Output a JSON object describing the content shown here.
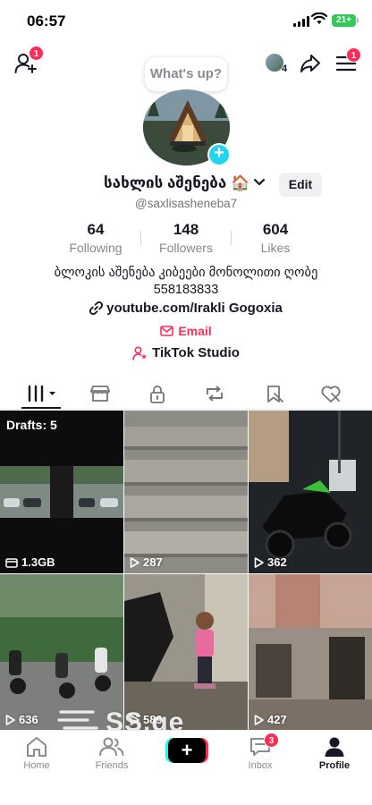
{
  "status_bar": {
    "time": "06:57",
    "battery": "21+"
  },
  "top": {
    "add_friend_badge": "1",
    "mini_avatar_count": "4",
    "menu_badge": "1",
    "whats_up": "What's up?"
  },
  "profile": {
    "name": "სახლის აშენება 🏠",
    "handle": "@saxlisasheneba7",
    "edit_label": "Edit",
    "following_count": "64",
    "following_label": "Following",
    "followers_count": "148",
    "followers_label": "Followers",
    "likes_count": "604",
    "likes_label": "Likes",
    "bio_line1": "ბლოკის აშენება კიბეები მონოლითი ღობე",
    "bio_line2": "558183833",
    "link": "youtube.com/Irakli Gogoxia",
    "email_label": "Email",
    "studio_label": "TikTok Studio"
  },
  "tabs": [
    "videos-tab",
    "shop-tab",
    "private-tab",
    "reposts-tab",
    "favorites-tab",
    "liked-tab"
  ],
  "grid": {
    "drafts_label": "Drafts: 5",
    "items": [
      {
        "views": "1.3GB"
      },
      {
        "views": "287"
      },
      {
        "views": "362"
      },
      {
        "views": "636"
      },
      {
        "views": "589"
      },
      {
        "views": "427"
      }
    ]
  },
  "bottom_nav": {
    "home": "Home",
    "friends": "Friends",
    "inbox": "Inbox",
    "inbox_badge": "3",
    "profile": "Profile"
  },
  "watermark": "SS.ge",
  "colors": {
    "accent": "#fe2c55",
    "cyan": "#20d5ec",
    "text": "#161823",
    "muted": "#86878b"
  }
}
